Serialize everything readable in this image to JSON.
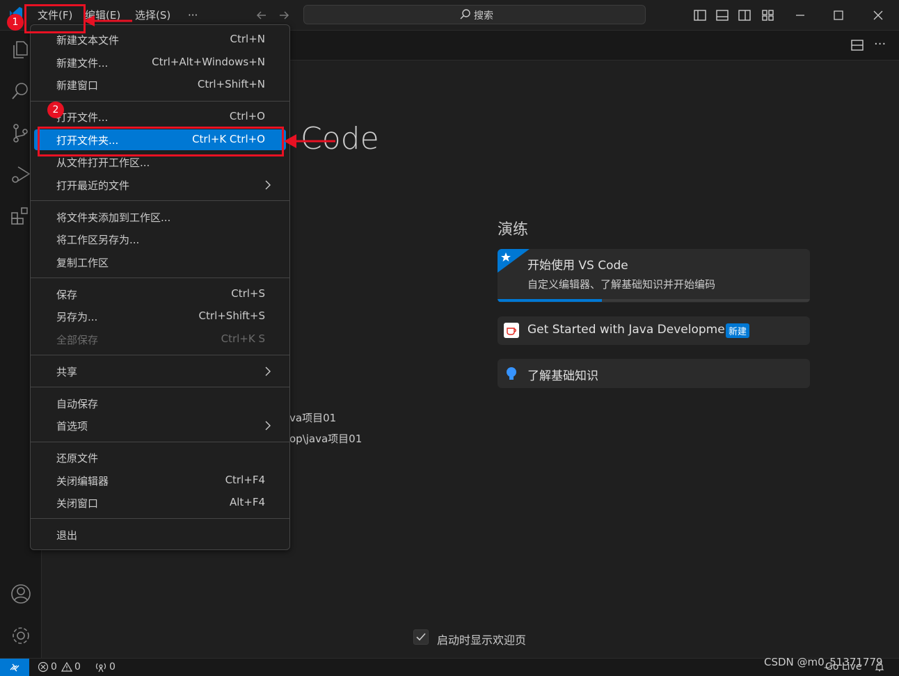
{
  "menubar": {
    "file": "文件(F)",
    "edit": "编辑(E)",
    "selection": "选择(S)",
    "more": "···"
  },
  "search": {
    "label": "搜索"
  },
  "welcome": {
    "title_fragment": "Code",
    "walkthroughs_title": "演练",
    "card1_title": "开始使用 VS Code",
    "card1_desc": "自定义编辑器、了解基础知识并开始编码",
    "card2_title": "Get Started with Java Development",
    "card2_badge": "新建",
    "card3_title": "了解基础知识",
    "recent_1": "va项目01",
    "recent_2": "op\\java项目01",
    "show_on_startup": "启动时显示欢迎页"
  },
  "file_menu": {
    "items": [
      {
        "label": "新建文本文件",
        "shortcut": "Ctrl+N"
      },
      {
        "label": "新建文件...",
        "shortcut": "Ctrl+Alt+Windows+N"
      },
      {
        "label": "新建窗口",
        "shortcut": "Ctrl+Shift+N"
      },
      {
        "label": "打开文件...",
        "shortcut": "Ctrl+O"
      },
      {
        "label": "打开文件夹...",
        "shortcut": "Ctrl+K Ctrl+O"
      },
      {
        "label": "从文件打开工作区...",
        "shortcut": ""
      },
      {
        "label": "打开最近的文件",
        "shortcut": ""
      },
      {
        "label": "将文件夹添加到工作区...",
        "shortcut": ""
      },
      {
        "label": "将工作区另存为...",
        "shortcut": ""
      },
      {
        "label": "复制工作区",
        "shortcut": ""
      },
      {
        "label": "保存",
        "shortcut": "Ctrl+S"
      },
      {
        "label": "另存为...",
        "shortcut": "Ctrl+Shift+S"
      },
      {
        "label": "全部保存",
        "shortcut": "Ctrl+K S"
      },
      {
        "label": "共享",
        "shortcut": ""
      },
      {
        "label": "自动保存",
        "shortcut": ""
      },
      {
        "label": "首选项",
        "shortcut": ""
      },
      {
        "label": "还原文件",
        "shortcut": ""
      },
      {
        "label": "关闭编辑器",
        "shortcut": "Ctrl+F4"
      },
      {
        "label": "关闭窗口",
        "shortcut": "Alt+F4"
      },
      {
        "label": "退出",
        "shortcut": ""
      }
    ]
  },
  "annotations": {
    "badge1": "1",
    "badge2": "2"
  },
  "statusbar": {
    "errors": "0",
    "warnings": "0",
    "ports": "0",
    "golive": "Go Live"
  },
  "watermark": "CSDN @m0_51371779",
  "colors": {
    "accent": "#0078d4",
    "annotation": "#e81123"
  }
}
